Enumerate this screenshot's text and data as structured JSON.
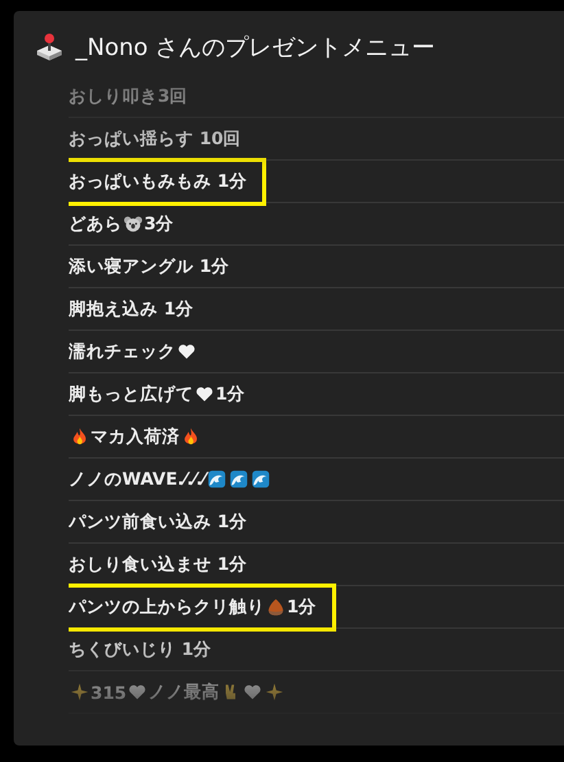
{
  "window": {
    "title": "_Nono さんのプレゼントメニュー"
  },
  "items": [
    {
      "parts": [
        {
          "kind": "text",
          "text": "おしり叩き3回"
        }
      ],
      "highlighted": false
    },
    {
      "parts": [
        {
          "kind": "text",
          "text": "おっぱい揺らす 10回"
        }
      ],
      "highlighted": false
    },
    {
      "parts": [
        {
          "kind": "text",
          "text": "おっぱいもみもみ 1分"
        }
      ],
      "highlighted": true
    },
    {
      "parts": [
        {
          "kind": "text",
          "text": "どあら"
        },
        {
          "kind": "koala"
        },
        {
          "kind": "text",
          "text": "3分"
        }
      ],
      "highlighted": false
    },
    {
      "parts": [
        {
          "kind": "text",
          "text": "添い寝アングル 1分"
        }
      ],
      "highlighted": false
    },
    {
      "parts": [
        {
          "kind": "text",
          "text": "脚抱え込み 1分"
        }
      ],
      "highlighted": false
    },
    {
      "parts": [
        {
          "kind": "text",
          "text": "濡れチェック"
        },
        {
          "kind": "heart"
        }
      ],
      "highlighted": false
    },
    {
      "parts": [
        {
          "kind": "text",
          "text": "脚もっと広げて"
        },
        {
          "kind": "heart"
        },
        {
          "kind": "text",
          "text": " 1分"
        }
      ],
      "highlighted": false
    },
    {
      "parts": [
        {
          "kind": "fire"
        },
        {
          "kind": "text",
          "text": "マカ入荷済"
        },
        {
          "kind": "fire"
        }
      ],
      "highlighted": false
    },
    {
      "parts": [
        {
          "kind": "text",
          "text": "ノノのWAVE.⁄.⁄.⁄"
        },
        {
          "kind": "wave"
        },
        {
          "kind": "wave"
        },
        {
          "kind": "wave"
        }
      ],
      "highlighted": false
    },
    {
      "parts": [
        {
          "kind": "text",
          "text": "パンツ前食い込み 1分"
        }
      ],
      "highlighted": false
    },
    {
      "parts": [
        {
          "kind": "text",
          "text": "おしり食い込ませ 1分"
        }
      ],
      "highlighted": false
    },
    {
      "parts": [
        {
          "kind": "text",
          "text": "パンツの上からクリ触り"
        },
        {
          "kind": "chestnut"
        },
        {
          "kind": "text",
          "text": "1分"
        }
      ],
      "highlighted": true
    },
    {
      "parts": [
        {
          "kind": "text",
          "text": "ちくびいじり 1分"
        }
      ],
      "highlighted": false
    },
    {
      "parts": [
        {
          "kind": "sparkle"
        },
        {
          "kind": "text",
          "text": "315"
        },
        {
          "kind": "heart"
        },
        {
          "kind": "text",
          "text": "ノノ最高"
        },
        {
          "kind": "peace"
        },
        {
          "kind": "heart"
        },
        {
          "kind": "sparkle"
        }
      ],
      "highlighted": false
    }
  ]
}
